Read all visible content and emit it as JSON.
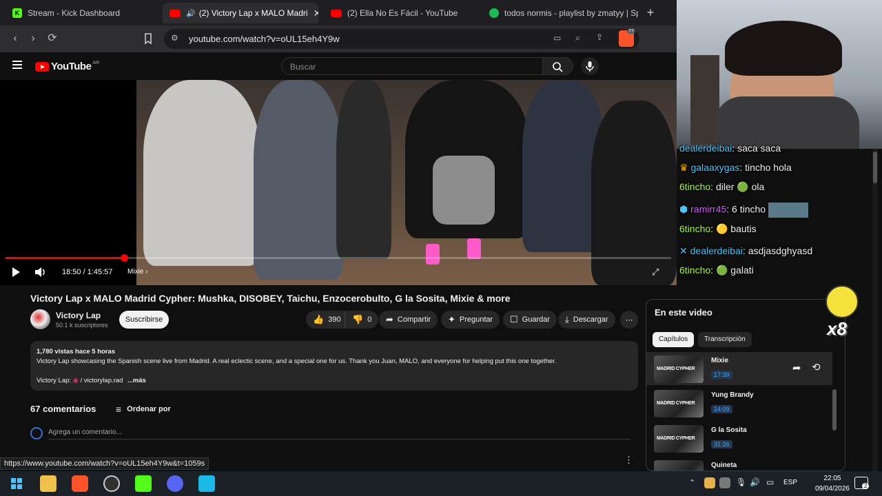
{
  "browser": {
    "tabs": [
      {
        "label": "Stream - Kick Dashboard",
        "color": "#53fc18"
      },
      {
        "label": "(2) Victory Lap x MALO Madri",
        "color": "#ff0000"
      },
      {
        "label": "(2) Ella No Es Fácil - YouTube",
        "color": "#ff0000"
      },
      {
        "label": "todos normis - playlist by zmatyy | Sp",
        "color": "#1db954"
      }
    ],
    "url": "youtube.com/watch?v=oUL15eh4Y9w",
    "brave_badge": "77"
  },
  "youtube": {
    "logo": "YouTube",
    "country": "AR",
    "search_placeholder": "Buscar"
  },
  "player": {
    "time": "18:50 / 1:45:57",
    "chapter": "Mixie",
    "progress": 0.178
  },
  "video": {
    "title": "Victory Lap x MALO Madrid Cypher: Mushka, DISOBEY, Taichu, Enzocerobulto, G la Sosita, Mixie & more",
    "channel": "Victory Lap",
    "subscribers": "50.1 k suscriptores",
    "subscribe_label": "Suscribirse",
    "likes": "390",
    "dislikes": "0",
    "share": "Compartir",
    "ask": "Preguntar",
    "save": "Guardar",
    "download": "Descargar"
  },
  "description": {
    "stats": "1,780 vistas  hace 5 horas",
    "text": "Victory Lap showcasing the Spanish scene live from Madrid. A real eclectic scene, and a special one for us. Thank you Juan, MALO, and everyone for helping put this one together.",
    "link_prefix": "Victory Lap:",
    "link": "/ victorylap.rad",
    "more": "...más"
  },
  "comments": {
    "count": "67 comentarios",
    "sort": "Ordenar por",
    "placeholder": "Agrega un comentario..."
  },
  "status_url": "https://www.youtube.com/watch?v=oUL15eh4Y9w&t=1059s",
  "chapters_panel": {
    "title": "En este video",
    "chip_chapters": "Capítulos",
    "chip_transcript": "Transcripción",
    "items": [
      {
        "name": "Mixie",
        "time": "17:39"
      },
      {
        "name": "Yung Brandy",
        "time": "24:09"
      },
      {
        "name": "G la Sosita",
        "time": "31:26"
      },
      {
        "name": "Quineta",
        "time": ""
      }
    ]
  },
  "chat": {
    "messages": [
      {
        "user": "dealerdeibai",
        "text": "saca saca",
        "user_color": "#4fc3f7"
      },
      {
        "user": "galaaxygas",
        "text": "tincho hola",
        "user_color": "#4fc3f7"
      },
      {
        "user": "6tincho",
        "text": "diler 🟢 ola",
        "user_color": "#a4ff3c"
      },
      {
        "user": "ramirr45",
        "text": "6 tincho",
        "user_color": "#d15cff"
      },
      {
        "user": "6tincho",
        "text": "🟡 bautis",
        "user_color": "#a4ff3c"
      },
      {
        "user": "dealerdeibai",
        "text": "asdjasdghyasd",
        "user_color": "#4fc3f7"
      },
      {
        "user": "6tincho",
        "text": "🟢 galati",
        "user_color": "#a4ff3c"
      }
    ],
    "badge": "x8"
  },
  "taskbar": {
    "lang": "ESP",
    "time": "22:05",
    "date": "09/04/2026",
    "notif": "2"
  }
}
